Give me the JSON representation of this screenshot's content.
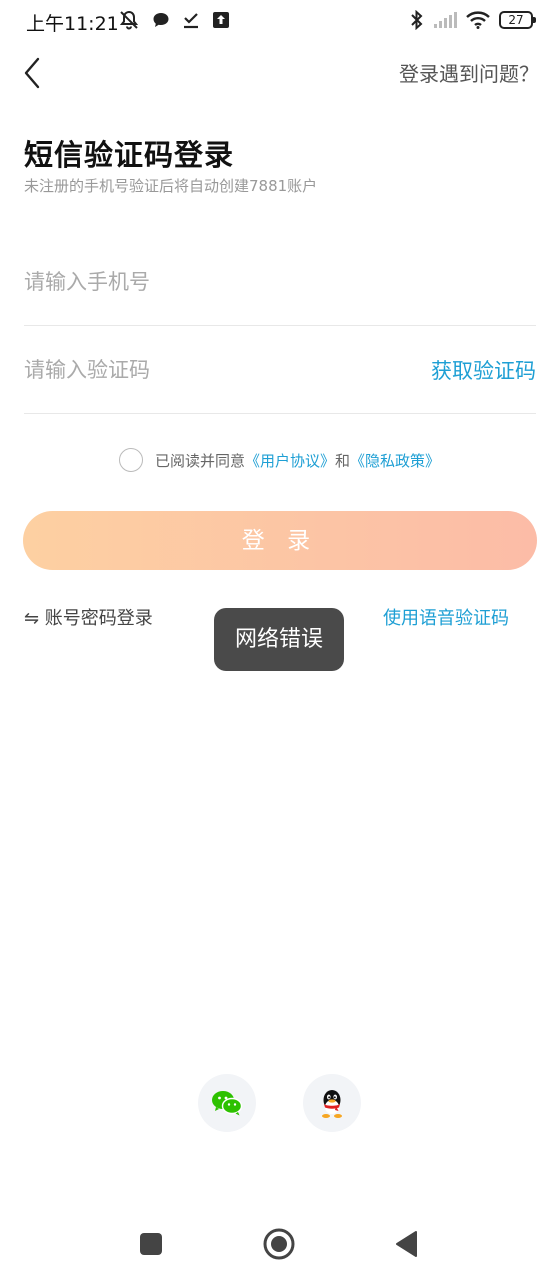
{
  "status_bar": {
    "time": "上午11:21",
    "battery_level": "27",
    "icons_left": [
      "mute-icon",
      "chat-bubble-icon",
      "check-download-icon",
      "upload-icon"
    ],
    "icons_right": [
      "bluetooth-icon",
      "signal-icon",
      "wifi-icon",
      "battery-icon"
    ]
  },
  "header": {
    "help_link": "登录遇到问题？"
  },
  "title": "短信验证码登录",
  "subtitle": "未注册的手机号验证后将自动创建7881账户",
  "form": {
    "phone_placeholder": "请输入手机号",
    "phone_value": "",
    "code_placeholder": "请输入验证码",
    "code_value": "",
    "get_code_label": "获取验证码"
  },
  "agreement": {
    "prefix": "已阅读并同意",
    "user_agreement": "《用户协议》",
    "and": "和",
    "privacy_policy": "《隐私政策》",
    "checked": false
  },
  "login_button": "登 录",
  "alt_links": {
    "password_login": "⇋ 账号密码登录",
    "voice_code": "使用语音验证码"
  },
  "toast": "网络错误",
  "colors": {
    "accent_blue": "#1e9fd4",
    "login_gradient_start": "#fdd0a2",
    "login_gradient_end": "#fcbca7",
    "wechat_green": "#2dc100"
  },
  "social_login": [
    "wechat-icon",
    "qq-icon"
  ],
  "nav_bar": [
    "recents-square-icon",
    "home-circle-icon",
    "back-triangle-icon"
  ]
}
